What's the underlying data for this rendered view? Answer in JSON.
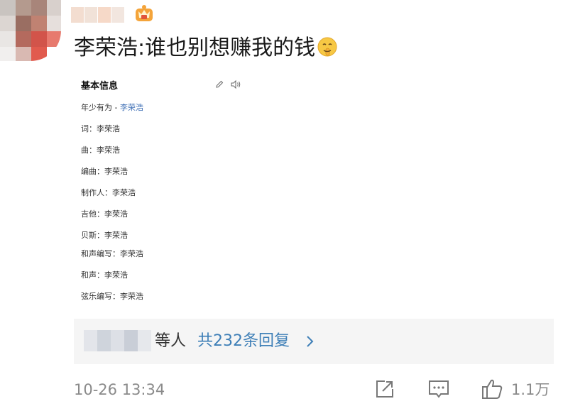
{
  "comment": {
    "text": "李荣浩:谁也别想赚我的钱",
    "emoji_icon": "shushing-face-icon",
    "badge_icon": "crown-vip-icon"
  },
  "card": {
    "heading": "基本信息",
    "song_prefix": "年少有为 - ",
    "song_artist": "李荣浩",
    "rows": [
      "词：李荣浩",
      "曲：李荣浩",
      "编曲：李荣浩",
      "制作人：李荣浩",
      "吉他：李荣浩",
      "贝斯：李荣浩",
      "和声编写：李荣浩",
      "和声：李荣浩",
      "弦乐编写：李荣浩"
    ]
  },
  "replies": {
    "suffix": "等人",
    "count_label": "共232条回复"
  },
  "footer": {
    "timestamp": "10-26 13:34",
    "like_count": "1.1万"
  },
  "colors": {
    "link_blue": "#3e7fb7",
    "meta_gray": "#8a8a8a",
    "reply_bg": "#f5f5f5"
  }
}
